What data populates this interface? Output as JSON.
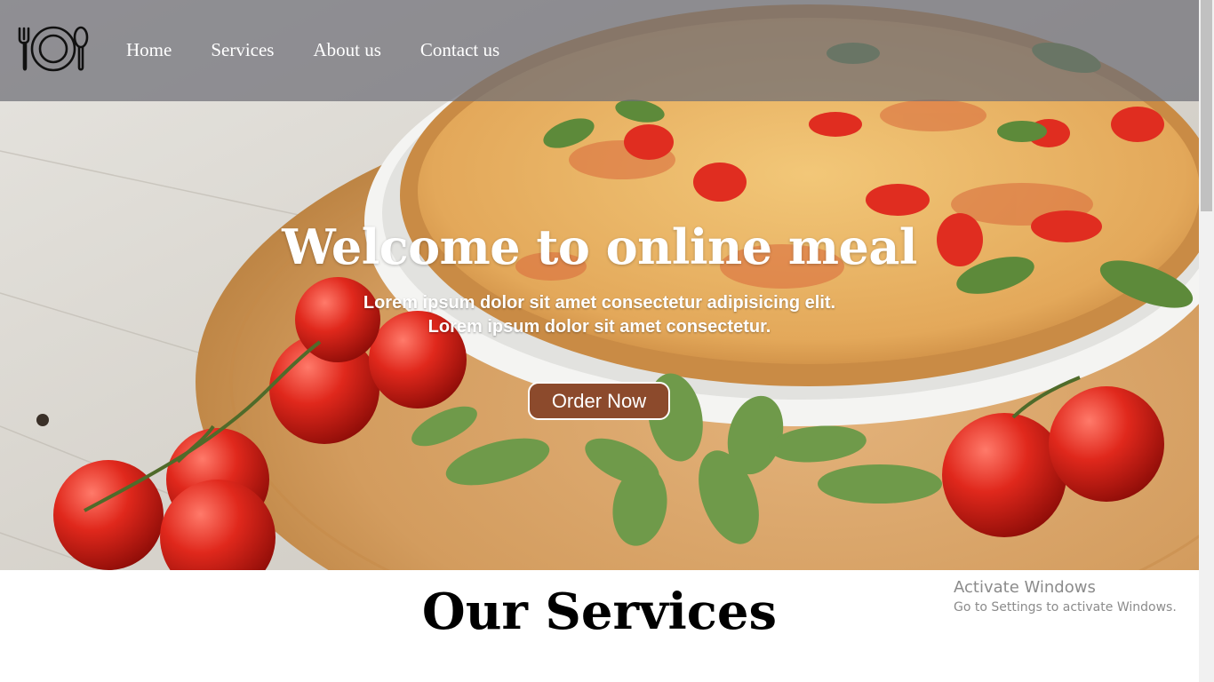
{
  "nav": {
    "logo_icon": "plate-fork-spoon-icon",
    "links": [
      {
        "label": "Home"
      },
      {
        "label": "Services"
      },
      {
        "label": "About us"
      },
      {
        "label": "Contact us"
      }
    ]
  },
  "hero": {
    "title": "Welcome to online meal",
    "subtitle_line1": "Lorem ipsum dolor sit amet consectetur adipisicing elit.",
    "subtitle_line2": "Lorem ipsum dolor sit amet consectetur.",
    "button_label": "Order Now",
    "background_image": "pizza-with-tomatoes-and-basil",
    "button_color": "#8c4a2c"
  },
  "services": {
    "title": "Our Services"
  },
  "watermark": {
    "title": "Activate Windows",
    "subtitle": "Go to Settings to activate Windows."
  }
}
